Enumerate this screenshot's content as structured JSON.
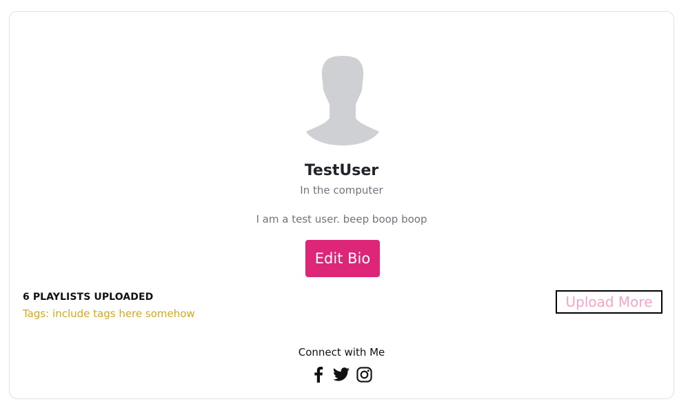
{
  "profile": {
    "username": "TestUser",
    "location": "In the computer",
    "bio": "I am a test user. beep boop boop",
    "edit_bio_label": "Edit Bio"
  },
  "stats": {
    "playlists_label": "6 PLAYLISTS UPLOADED",
    "tags_label": "Tags: include tags here somehow",
    "upload_more_label": "Upload More"
  },
  "social": {
    "heading": "Connect with Me",
    "icons": [
      "facebook-icon",
      "twitter-icon",
      "instagram-icon"
    ]
  },
  "colors": {
    "accent": "#dd2677",
    "tags": "#d4a71c",
    "upload_text": "#f5a3c8",
    "avatar": "#cfd0d3"
  }
}
